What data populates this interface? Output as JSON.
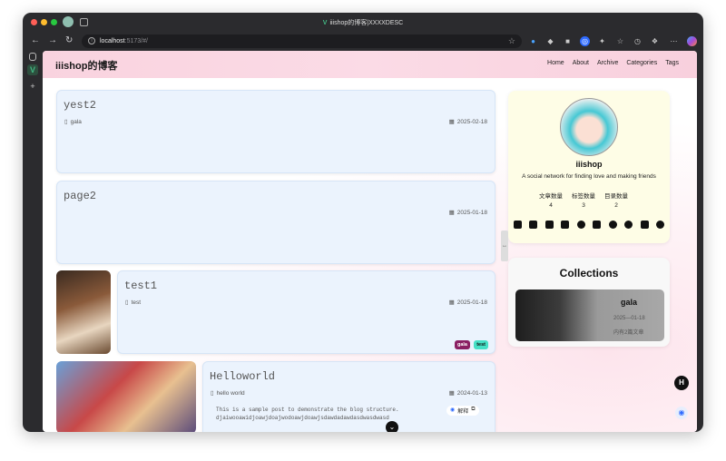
{
  "browser": {
    "tab_title": "iiishop的博客|XXXXDESC",
    "url_host": "localhost",
    "url_rest": ":5173/#/"
  },
  "site": {
    "brand": "iiishop的博客",
    "menu": [
      "Home",
      "About",
      "Archive",
      "Categories",
      "Tags"
    ]
  },
  "posts": [
    {
      "title": "yest2",
      "category": "gala",
      "date": "2025-02-18"
    },
    {
      "title": "page2",
      "date": "2025-01-18"
    },
    {
      "title": "test1",
      "category": "test",
      "date": "2025-01-18",
      "tags": [
        "gala",
        "test"
      ]
    },
    {
      "title": "Helloworld",
      "category": "hello world",
      "date": "2024-01-13",
      "excerpt_line1": "This is a sample post to demonstrate the blog structure.",
      "excerpt_line2": "djaiwooawidjoawjdoajwodoawjdoawjsdawdadawdasdwasdwasd",
      "translate_label": "解释"
    }
  ],
  "profile": {
    "name": "iiishop",
    "bio": "A social network for finding love and making friends",
    "stats": [
      {
        "label": "文章数量",
        "value": "4"
      },
      {
        "label": "标签数量",
        "value": "3"
      },
      {
        "label": "目录数量",
        "value": "2"
      }
    ],
    "social_icons": [
      "github-icon",
      "linkedin-icon",
      "twitter-icon",
      "instagram-icon",
      "facebook-icon",
      "youtube-icon",
      "pinterest-icon",
      "steam-icon",
      "twitch-icon",
      "reddit-icon"
    ]
  },
  "collections": {
    "title": "Collections",
    "items": [
      {
        "name": "gala",
        "date": "2025—01-18",
        "count": "内有2篇文章"
      }
    ]
  },
  "colors": {
    "tag_gala": "#8a1f62",
    "tag_test": "#45e0c6",
    "card_bg": "#ebf3fd",
    "profile_bg": "#fefde6"
  }
}
